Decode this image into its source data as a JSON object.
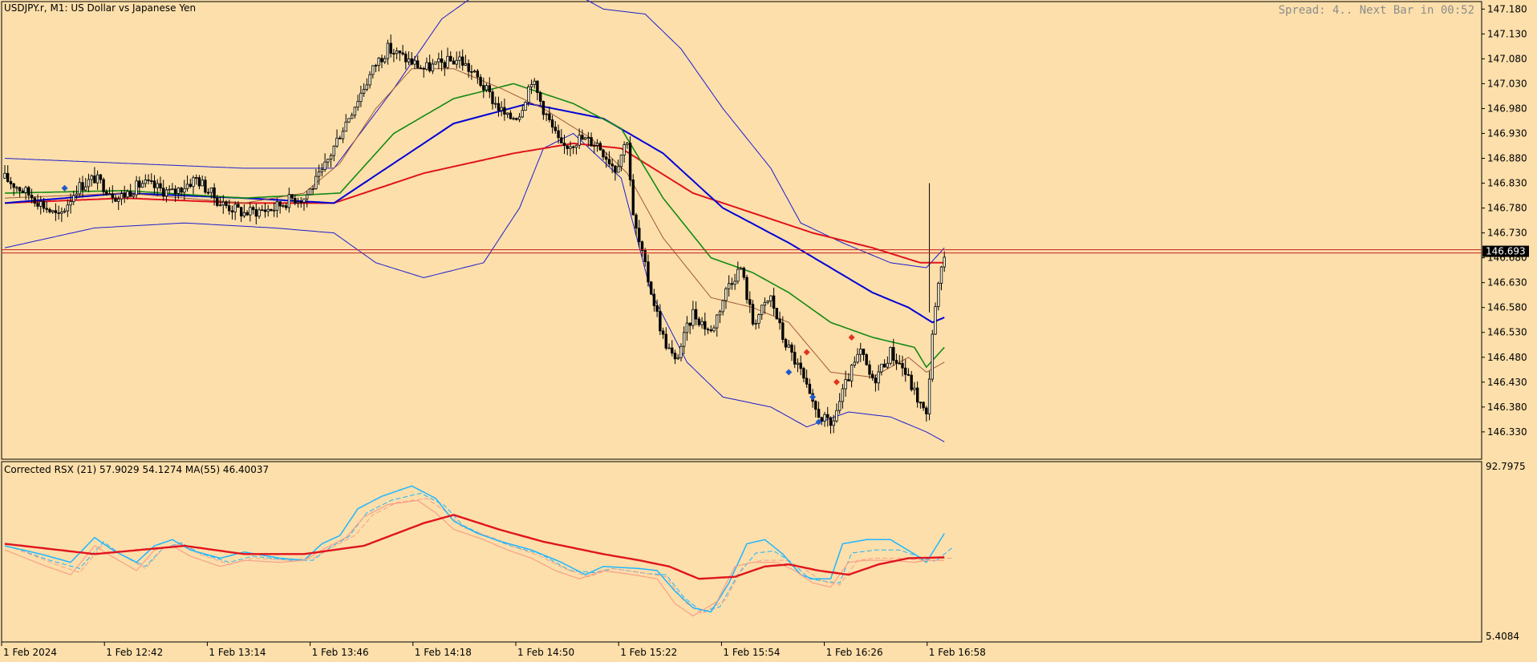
{
  "header": {
    "symbol": "USDJPY.r,",
    "timeframe": "M1:",
    "description": "US Dollar vs Japanese Yen",
    "status_text": "Spread: 4.. Next Bar in 00:52"
  },
  "indicator": {
    "label": "Corrected RSX (21) 57.9029 54.1274 MA(55) 46.40037",
    "axis_top": "92.7975",
    "axis_bottom": "5.4084"
  },
  "colors": {
    "background": "#fcdfab",
    "grid_frame": "#000000",
    "bull": "#1f1f1f",
    "bear": "#000000",
    "ma_fast": "#a05a3c",
    "ma_mid": "#138a13",
    "ma_slow": "#0000d8",
    "ma_long": "#e0141e",
    "bands": "#1c1cd0",
    "rsx_fast": "#1fb6ff",
    "rsx_signal": "#f7a088",
    "rsx_ma": "#e0141e",
    "price_line": "#c81e1e"
  },
  "chart_data": [
    {
      "type": "candlestick",
      "title": "USDJPY.r, M1: US Dollar vs Japanese Yen",
      "ylim": [
        146.275,
        147.195
      ],
      "y_ticks": [
        "147.180",
        "147.130",
        "147.080",
        "147.030",
        "146.980",
        "146.930",
        "146.880",
        "146.830",
        "146.780",
        "146.730",
        "146.680",
        "146.630",
        "146.580",
        "146.530",
        "146.480",
        "146.430",
        "146.380",
        "146.330"
      ],
      "current_price": "146.693",
      "x_tick_labels": [
        "1 Feb 2024",
        "1 Feb 12:42",
        "1 Feb 13:14",
        "1 Feb 13:46",
        "1 Feb 14:18",
        "1 Feb 14:50",
        "1 Feb 15:22",
        "1 Feb 15:54",
        "1 Feb 16:26",
        "1 Feb 16:58"
      ],
      "close_path": [
        [
          0,
          146.84
        ],
        [
          10,
          146.8
        ],
        [
          18,
          146.76
        ],
        [
          24,
          146.82
        ],
        [
          30,
          146.84
        ],
        [
          38,
          146.8
        ],
        [
          46,
          146.83
        ],
        [
          56,
          146.81
        ],
        [
          64,
          146.84
        ],
        [
          72,
          146.79
        ],
        [
          80,
          146.77
        ],
        [
          90,
          146.78
        ],
        [
          96,
          146.8
        ],
        [
          100,
          146.8
        ],
        [
          106,
          146.85
        ],
        [
          112,
          146.93
        ],
        [
          118,
          147.0
        ],
        [
          124,
          147.07
        ],
        [
          128,
          147.1
        ],
        [
          134,
          147.08
        ],
        [
          140,
          147.06
        ],
        [
          146,
          147.07
        ],
        [
          152,
          147.08
        ],
        [
          158,
          147.04
        ],
        [
          164,
          146.99
        ],
        [
          168,
          146.96
        ],
        [
          172,
          146.97
        ],
        [
          176,
          147.04
        ],
        [
          180,
          146.98
        ],
        [
          186,
          146.9
        ],
        [
          192,
          146.92
        ],
        [
          198,
          146.91
        ],
        [
          204,
          146.86
        ],
        [
          208,
          146.92
        ],
        [
          210,
          146.76
        ],
        [
          214,
          146.66
        ],
        [
          220,
          146.52
        ],
        [
          224,
          146.47
        ],
        [
          230,
          146.57
        ],
        [
          236,
          146.53
        ],
        [
          242,
          146.63
        ],
        [
          246,
          146.66
        ],
        [
          250,
          146.55
        ],
        [
          256,
          146.6
        ],
        [
          260,
          146.52
        ],
        [
          266,
          146.45
        ],
        [
          270,
          146.38
        ],
        [
          276,
          146.34
        ],
        [
          282,
          146.44
        ],
        [
          286,
          146.49
        ],
        [
          290,
          146.43
        ],
        [
          296,
          146.49
        ],
        [
          300,
          146.46
        ],
        [
          304,
          146.41
        ],
        [
          308,
          146.36
        ],
        [
          310,
          146.53
        ],
        [
          312,
          146.62
        ],
        [
          314,
          146.68
        ]
      ],
      "ma_fast": [
        [
          0,
          146.8
        ],
        [
          40,
          146.81
        ],
        [
          80,
          146.79
        ],
        [
          100,
          146.81
        ],
        [
          112,
          146.87
        ],
        [
          124,
          146.98
        ],
        [
          136,
          147.06
        ],
        [
          150,
          147.06
        ],
        [
          166,
          147.02
        ],
        [
          180,
          146.98
        ],
        [
          196,
          146.92
        ],
        [
          208,
          146.85
        ],
        [
          220,
          146.72
        ],
        [
          236,
          146.6
        ],
        [
          250,
          146.58
        ],
        [
          262,
          146.55
        ],
        [
          276,
          146.45
        ],
        [
          290,
          146.44
        ],
        [
          302,
          146.48
        ],
        [
          308,
          146.45
        ],
        [
          314,
          146.47
        ]
      ],
      "ma_mid": [
        [
          0,
          146.81
        ],
        [
          40,
          146.815
        ],
        [
          80,
          146.8
        ],
        [
          112,
          146.81
        ],
        [
          130,
          146.93
        ],
        [
          150,
          147.0
        ],
        [
          170,
          147.03
        ],
        [
          190,
          146.99
        ],
        [
          206,
          146.94
        ],
        [
          220,
          146.8
        ],
        [
          236,
          146.68
        ],
        [
          250,
          146.65
        ],
        [
          262,
          146.61
        ],
        [
          276,
          146.55
        ],
        [
          290,
          146.52
        ],
        [
          304,
          146.5
        ],
        [
          308,
          146.46
        ],
        [
          314,
          146.5
        ]
      ],
      "ma_slow": [
        [
          0,
          146.79
        ],
        [
          40,
          146.81
        ],
        [
          80,
          146.8
        ],
        [
          110,
          146.79
        ],
        [
          130,
          146.87
        ],
        [
          150,
          146.95
        ],
        [
          175,
          146.99
        ],
        [
          200,
          146.96
        ],
        [
          220,
          146.89
        ],
        [
          240,
          146.78
        ],
        [
          262,
          146.71
        ],
        [
          276,
          146.66
        ],
        [
          290,
          146.61
        ],
        [
          302,
          146.58
        ],
        [
          310,
          146.55
        ],
        [
          314,
          146.56
        ]
      ],
      "ma_long": [
        [
          0,
          146.79
        ],
        [
          40,
          146.8
        ],
        [
          80,
          146.79
        ],
        [
          110,
          146.79
        ],
        [
          140,
          146.85
        ],
        [
          170,
          146.89
        ],
        [
          190,
          146.91
        ],
        [
          206,
          146.9
        ],
        [
          230,
          146.81
        ],
        [
          250,
          146.77
        ],
        [
          270,
          146.73
        ],
        [
          290,
          146.7
        ],
        [
          306,
          146.67
        ],
        [
          314,
          146.67
        ]
      ],
      "band_upper": [
        [
          0,
          146.88
        ],
        [
          40,
          146.87
        ],
        [
          80,
          146.86
        ],
        [
          110,
          146.86
        ],
        [
          130,
          147.02
        ],
        [
          146,
          147.16
        ],
        [
          160,
          147.22
        ],
        [
          176,
          147.22
        ],
        [
          188,
          147.22
        ],
        [
          200,
          147.18
        ],
        [
          214,
          147.17
        ],
        [
          226,
          147.1
        ],
        [
          240,
          146.98
        ],
        [
          256,
          146.86
        ],
        [
          266,
          146.75
        ],
        [
          280,
          146.71
        ],
        [
          296,
          146.67
        ],
        [
          308,
          146.66
        ],
        [
          314,
          146.7
        ]
      ],
      "band_lower": [
        [
          0,
          146.7
        ],
        [
          30,
          146.74
        ],
        [
          60,
          146.75
        ],
        [
          90,
          146.74
        ],
        [
          110,
          146.73
        ],
        [
          124,
          146.67
        ],
        [
          140,
          146.64
        ],
        [
          160,
          146.67
        ],
        [
          172,
          146.78
        ],
        [
          180,
          146.9
        ],
        [
          190,
          146.93
        ],
        [
          206,
          146.84
        ],
        [
          216,
          146.61
        ],
        [
          228,
          146.47
        ],
        [
          240,
          146.4
        ],
        [
          256,
          146.38
        ],
        [
          268,
          146.34
        ],
        [
          282,
          146.37
        ],
        [
          296,
          146.36
        ],
        [
          308,
          146.33
        ],
        [
          314,
          146.31
        ]
      ],
      "fractal_markers": [
        {
          "i": 20,
          "price": 146.82,
          "dir": "up"
        },
        {
          "i": 262,
          "price": 146.45,
          "dir": "up"
        },
        {
          "i": 270,
          "price": 146.4,
          "dir": "up"
        },
        {
          "i": 272,
          "price": 146.35,
          "dir": "up"
        },
        {
          "i": 268,
          "price": 146.49,
          "dir": "down"
        },
        {
          "i": 278,
          "price": 146.43,
          "dir": "down"
        },
        {
          "i": 283,
          "price": 146.52,
          "dir": "down"
        }
      ]
    },
    {
      "type": "line",
      "title": "Corrected RSX (21) 57.9029 54.1274 MA(55) 46.40037",
      "ylim": [
        5.4084,
        92.7975
      ],
      "series": [
        {
          "values": [
            [
              0,
              52
            ],
            [
              12,
              48
            ],
            [
              22,
              44
            ],
            [
              30,
              56
            ],
            [
              36,
              50
            ],
            [
              44,
              44
            ],
            [
              50,
              52
            ],
            [
              56,
              55
            ],
            [
              62,
              50
            ],
            [
              72,
              46
            ],
            [
              80,
              49
            ],
            [
              92,
              46
            ],
            [
              100,
              45
            ],
            [
              106,
              53
            ],
            [
              112,
              57
            ],
            [
              118,
              70
            ],
            [
              126,
              76
            ],
            [
              136,
              81
            ],
            [
              144,
              75
            ],
            [
              150,
              64
            ],
            [
              158,
              58
            ],
            [
              166,
              54
            ],
            [
              176,
              50
            ],
            [
              186,
              44
            ],
            [
              194,
              38
            ],
            [
              200,
              42
            ],
            [
              212,
              41
            ],
            [
              218,
              40
            ],
            [
              224,
              30
            ],
            [
              230,
              22
            ],
            [
              236,
              20
            ],
            [
              242,
              34
            ],
            [
              248,
              53
            ],
            [
              254,
              55
            ],
            [
              260,
              48
            ],
            [
              266,
              38
            ],
            [
              270,
              36
            ],
            [
              276,
              36
            ],
            [
              280,
              53
            ],
            [
              288,
              55
            ],
            [
              296,
              55
            ],
            [
              304,
              48
            ],
            [
              308,
              44
            ],
            [
              314,
              58
            ]
          ]
        },
        {
          "values": [
            [
              0,
              50
            ],
            [
              14,
              42
            ],
            [
              22,
              38
            ],
            [
              30,
              52
            ],
            [
              38,
              45
            ],
            [
              44,
              40
            ],
            [
              50,
              50
            ],
            [
              56,
              52
            ],
            [
              62,
              47
            ],
            [
              72,
              42
            ],
            [
              80,
              45
            ],
            [
              92,
              44
            ],
            [
              100,
              45
            ],
            [
              106,
              50
            ],
            [
              114,
              56
            ],
            [
              120,
              66
            ],
            [
              128,
              72
            ],
            [
              138,
              74
            ],
            [
              144,
              68
            ],
            [
              150,
              60
            ],
            [
              160,
              55
            ],
            [
              168,
              50
            ],
            [
              176,
              46
            ],
            [
              184,
              40
            ],
            [
              192,
              36
            ],
            [
              200,
              40
            ],
            [
              210,
              38
            ],
            [
              218,
              36
            ],
            [
              224,
              24
            ],
            [
              230,
              18
            ],
            [
              238,
              25
            ],
            [
              244,
              42
            ],
            [
              250,
              44
            ],
            [
              258,
              44
            ],
            [
              264,
              40
            ],
            [
              270,
              34
            ],
            [
              276,
              32
            ],
            [
              282,
              44
            ],
            [
              288,
              45
            ],
            [
              296,
              45
            ],
            [
              304,
              44
            ],
            [
              308,
              45
            ],
            [
              314,
              45
            ]
          ]
        },
        {
          "values": [
            [
              0,
              53
            ],
            [
              30,
              48
            ],
            [
              60,
              52
            ],
            [
              80,
              48
            ],
            [
              100,
              48
            ],
            [
              120,
              52
            ],
            [
              140,
              63
            ],
            [
              150,
              67
            ],
            [
              165,
              60
            ],
            [
              180,
              54
            ],
            [
              200,
              48
            ],
            [
              212,
              45
            ],
            [
              222,
              42
            ],
            [
              232,
              36
            ],
            [
              244,
              37
            ],
            [
              254,
              42
            ],
            [
              262,
              43
            ],
            [
              272,
              40
            ],
            [
              282,
              38
            ],
            [
              292,
              43
            ],
            [
              302,
              46
            ],
            [
              314,
              46.4
            ]
          ]
        }
      ]
    }
  ]
}
